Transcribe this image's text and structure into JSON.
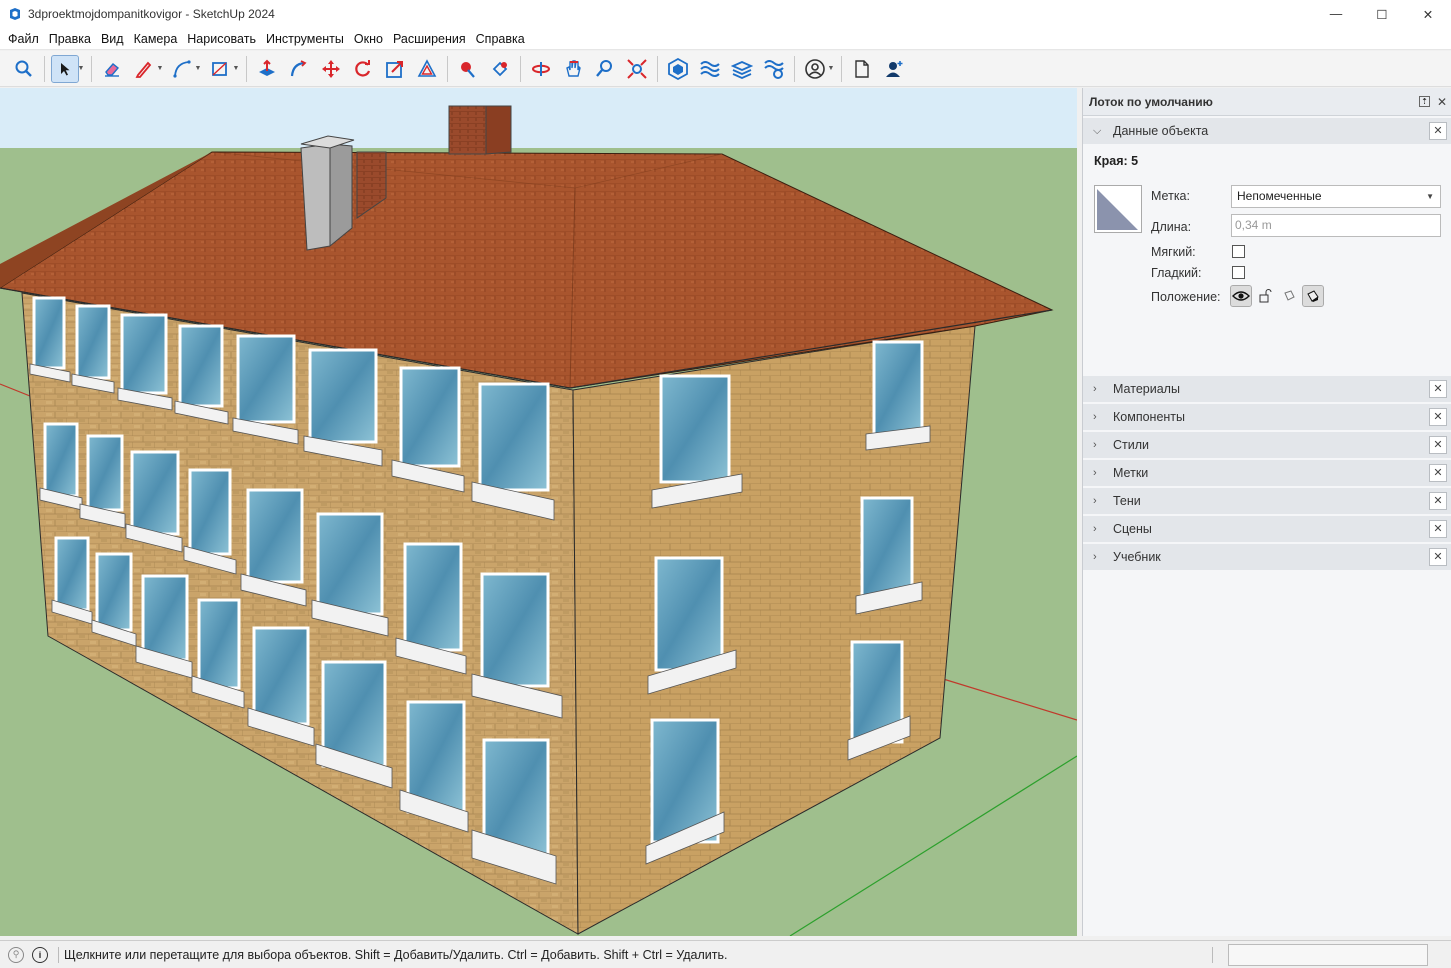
{
  "window": {
    "title": "3dproektmojdompanitkovigor - SketchUp 2024",
    "controls": {
      "minimize": "—",
      "maximize": "☐",
      "close": "✕"
    }
  },
  "menu": [
    "Файл",
    "Правка",
    "Вид",
    "Камера",
    "Нарисовать",
    "Инструменты",
    "Окно",
    "Расширения",
    "Справка"
  ],
  "toolbar": {
    "tools": [
      "search-icon",
      "select-arrow-icon",
      "eraser-icon",
      "pencil-line-icon",
      "arc-icon",
      "rectangle-icon",
      "push-pull-icon",
      "follow-me-icon",
      "move-icon",
      "rotate-icon",
      "scale-icon",
      "offset-icon",
      "tape-measure-icon",
      "paint-bucket-icon",
      "orbit-icon",
      "pan-icon",
      "zoom-icon",
      "zoom-extents-icon",
      "warehouse-icon",
      "extension-warehouse-icon",
      "layout-icon",
      "extension-manager-icon",
      "account-icon",
      "new-file-icon",
      "add-user-icon"
    ],
    "accent": "#1e6fc8",
    "danger": "#d9262b"
  },
  "tray": {
    "title": "Лоток по умолчанию",
    "entity_info": {
      "header": "Данные объекта",
      "edges_label": "Края: 5",
      "tag_label": "Метка:",
      "tag_value": "Непомеченные",
      "length_label": "Длина:",
      "length_value": "0,34 m",
      "soft_label": "Мягкий:",
      "smooth_label": "Гладкий:",
      "position_label": "Положение:"
    },
    "sections": [
      "Материалы",
      "Компоненты",
      "Стили",
      "Метки",
      "Тени",
      "Сцены",
      "Учебник"
    ]
  },
  "status": {
    "text": "Щелкните или перетащите для выбора объектов. Shift = Добавить/Удалить. Ctrl = Добавить. Shift + Ctrl = Удалить."
  },
  "colors": {
    "sky": "#d9ecf8",
    "ground": "#9fbf8d",
    "roof": "#a9552e",
    "wall": "#c9a46a",
    "glass": "#5f9fbc"
  }
}
